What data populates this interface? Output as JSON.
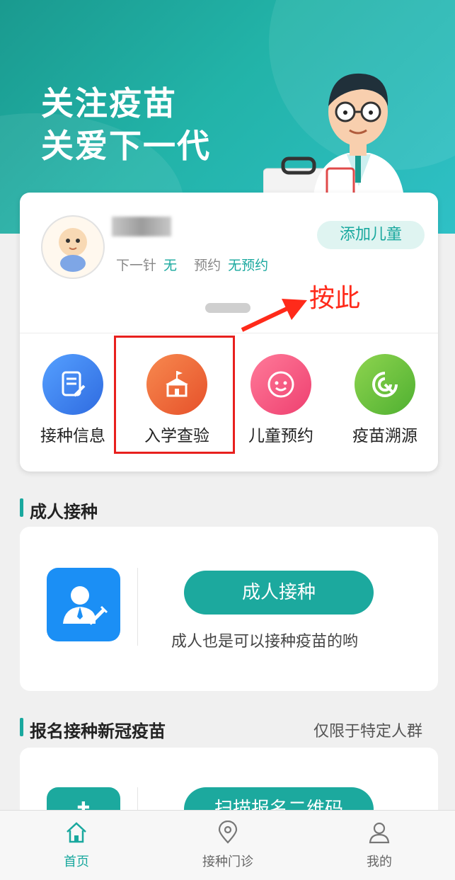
{
  "hero": {
    "line1": "关注疫苗",
    "line2": "关爱下一代"
  },
  "child": {
    "next_label": "下一针",
    "next_value": "无",
    "appt_label": "预约",
    "appt_value": "无预约",
    "add_button": "添加儿童"
  },
  "annotation": {
    "text": "按此"
  },
  "menu": [
    {
      "label": "接种信息",
      "color": "#3d7ef0",
      "icon": "document-edit-icon"
    },
    {
      "label": "入学查验",
      "color": "#f26a35",
      "icon": "school-icon"
    },
    {
      "label": "儿童预约",
      "color": "#f4587e",
      "icon": "baby-face-icon"
    },
    {
      "label": "疫苗溯源",
      "color": "#6bc23b",
      "icon": "trace-icon"
    }
  ],
  "adult_section": {
    "title": "成人接种",
    "button": "成人接种",
    "desc": "成人也是可以接种疫苗的哟"
  },
  "covid_section": {
    "title": "报名接种新冠疫苗",
    "note": "仅限于特定人群",
    "button": "扫描报名二维码"
  },
  "tabbar": [
    {
      "label": "首页",
      "icon": "home-icon",
      "active": true
    },
    {
      "label": "接种门诊",
      "icon": "location-pin-icon",
      "active": false
    },
    {
      "label": "我的",
      "icon": "user-icon",
      "active": false
    }
  ],
  "colors": {
    "accent": "#19a89e",
    "annotation": "#e8201e"
  }
}
